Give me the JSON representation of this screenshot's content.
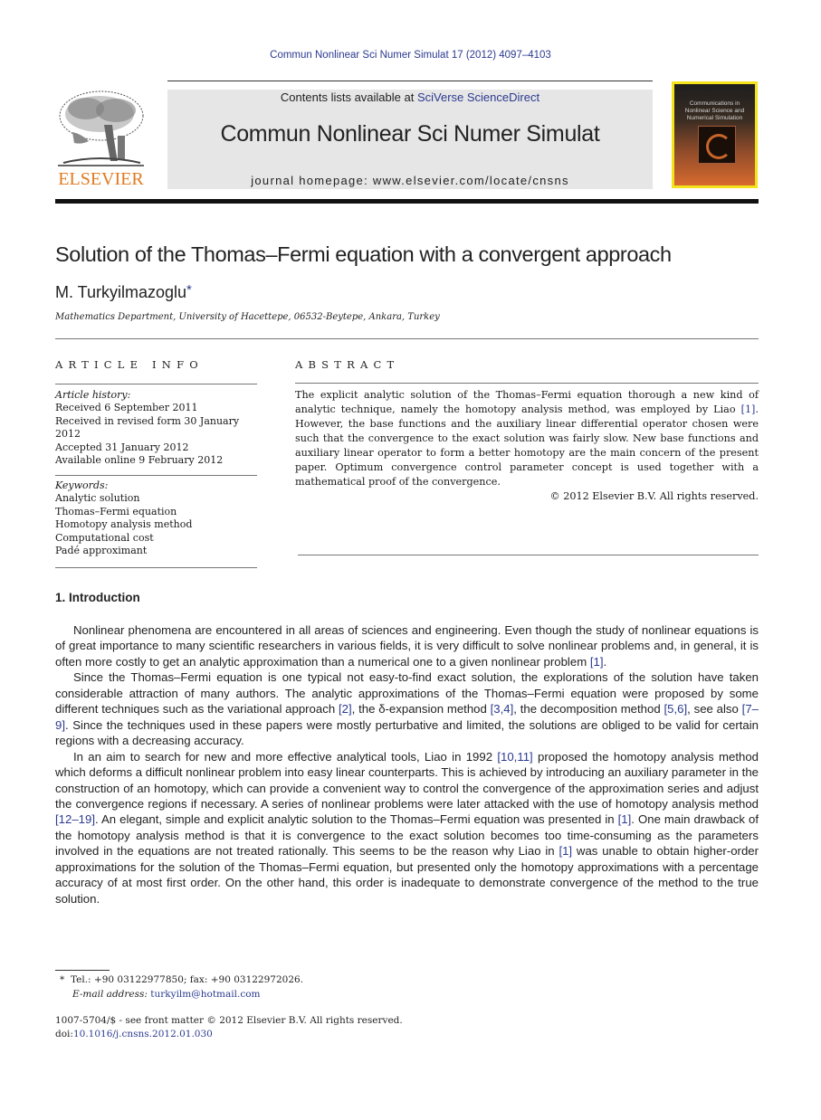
{
  "running_head": "Commun Nonlinear Sci Numer Simulat 17 (2012) 4097–4103",
  "publisher": {
    "logo_word": "ELSEVIER",
    "logo_icon": "elsevier-tree-icon",
    "brand_color": "#e07a20"
  },
  "journal_box": {
    "contents_prefix": "Contents lists available at ",
    "contents_link": "SciVerse ScienceDirect",
    "journal_title": "Commun Nonlinear Sci Numer Simulat",
    "homepage": "journal homepage: www.elsevier.com/locate/cnsns"
  },
  "cover": {
    "text": "Communications in Nonlinear Science and Numerical Simulation",
    "border_color": "#f2e31a"
  },
  "article": {
    "title": "Solution of the Thomas–Fermi equation with a convergent approach",
    "author": "M. Turkyilmazoglu",
    "author_mark": "*",
    "affiliation": "Mathematics Department, University of Hacettepe, 06532-Beytepe, Ankara, Turkey"
  },
  "article_info": {
    "heading": "ARTICLE INFO",
    "history_label": "Article history:",
    "history": [
      "Received 6 September 2011",
      "Received in revised form 30 January 2012",
      "Accepted 31 January 2012",
      "Available online 9 February 2012"
    ],
    "keywords_label": "Keywords:",
    "keywords": [
      "Analytic solution",
      "Thomas–Fermi equation",
      "Homotopy analysis method",
      "Computational cost",
      "Padé approximant"
    ]
  },
  "abstract": {
    "heading": "ABSTRACT",
    "text_before_ref": "The explicit analytic solution of the Thomas–Fermi equation thorough a new kind of analytic technique, namely the homotopy analysis method, was employed by Liao ",
    "ref": "[1]",
    "text_after_ref": ". However, the base functions and the auxiliary linear differential operator chosen were such that the convergence to the exact solution was fairly slow. New base functions and auxiliary linear operator to form a better homotopy are the main concern of the present paper. Optimum convergence control parameter concept is used together with a mathematical proof of the convergence.",
    "copyright": "© 2012 Elsevier B.V. All rights reserved."
  },
  "introduction": {
    "heading": "1. Introduction",
    "paragraphs": [
      [
        {
          "t": "Nonlinear phenomena are encountered in all areas of sciences and engineering. Even though the study of nonlinear equations is of great importance to many scientific researchers in various fields, it is very difficult to solve nonlinear problems and, in general, it is often more costly to get an analytic approximation than a numerical one to a given nonlinear problem "
        },
        {
          "ref": "[1]"
        },
        {
          "t": "."
        }
      ],
      [
        {
          "t": "Since the Thomas–Fermi equation is one typical not easy-to-find exact solution, the explorations of the solution have taken considerable attraction of many authors. The analytic approximations of the Thomas–Fermi equation were proposed by some different techniques such as the variational approach "
        },
        {
          "ref": "[2]"
        },
        {
          "t": ", the δ-expansion method "
        },
        {
          "ref": "[3,4]"
        },
        {
          "t": ", the decomposition method "
        },
        {
          "ref": "[5,6]"
        },
        {
          "t": ", see also "
        },
        {
          "ref": "[7–9]"
        },
        {
          "t": ". Since the techniques used in these papers were mostly perturbative and limited, the solutions are obliged to be valid for certain regions with a decreasing accuracy."
        }
      ],
      [
        {
          "t": "In an aim to search for new and more effective analytical tools, Liao in 1992 "
        },
        {
          "ref": "[10,11]"
        },
        {
          "t": " proposed the homotopy analysis method which deforms a difficult nonlinear problem into easy linear counterparts. This is achieved by introducing an auxiliary parameter in the construction of an homotopy, which can provide a convenient way to control the convergence of the approximation series and adjust the convergence regions if necessary. A series of nonlinear problems were later attacked with the use of homotopy analysis method "
        },
        {
          "ref": "[12–19]"
        },
        {
          "t": ". An elegant, simple and explicit analytic solution to the Thomas–Fermi equation was presented in "
        },
        {
          "ref": "[1]"
        },
        {
          "t": ". One main drawback of the homotopy analysis method is that it is convergence to the exact solution becomes too time-consuming as the parameters involved in the equations are not treated rationally. This seems to be the reason why Liao in "
        },
        {
          "ref": "[1]"
        },
        {
          "t": " was unable to obtain higher-order approximations for the solution of the Thomas–Fermi equation, but presented only the homotopy approximations with a percentage accuracy of at most first order. On the other hand, this order is inadequate to demonstrate convergence of the method to the true solution."
        }
      ]
    ]
  },
  "footnote": {
    "mark": "*",
    "contact": "Tel.: +90 03122977850; fax: +90 03122972026.",
    "email_label": "E-mail address:",
    "email": "turkyilm@hotmail.com"
  },
  "front_matter": {
    "issn_line": "1007-5704/$ - see front matter © 2012 Elsevier B.V. All rights reserved.",
    "doi_prefix": "doi:",
    "doi": "10.1016/j.cnsns.2012.01.030"
  },
  "link_color": "#2b3a8f"
}
